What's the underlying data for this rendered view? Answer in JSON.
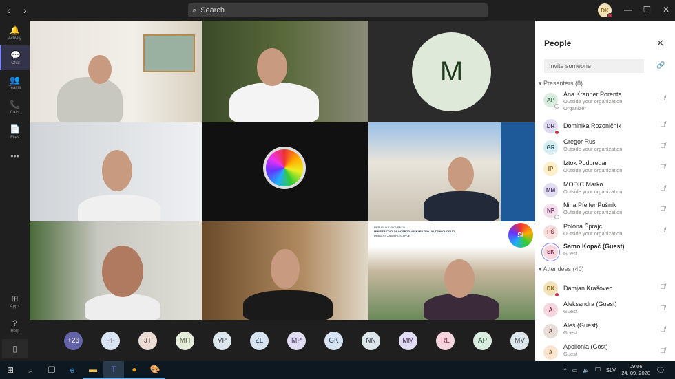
{
  "titlebar": {
    "search_placeholder": "Search",
    "user_initials": "DK"
  },
  "rail": [
    {
      "label": "Activity",
      "icon": "bell-icon",
      "g": "🔔"
    },
    {
      "label": "Chat",
      "icon": "chat-icon",
      "g": "💬"
    },
    {
      "label": "Teams",
      "icon": "teams-icon",
      "g": "👥"
    },
    {
      "label": "Calls",
      "icon": "phone-icon",
      "g": "📞"
    },
    {
      "label": "Files",
      "icon": "file-icon",
      "g": "📄"
    },
    {
      "label": "",
      "icon": "more-icon",
      "g": "•••"
    }
  ],
  "rail_bottom": [
    {
      "label": "Apps",
      "g": "⊞"
    },
    {
      "label": "Help",
      "g": "?"
    }
  ],
  "stage": {
    "m_initial": "M",
    "slide": {
      "line1": "REPUBLIKA SLOVENIJA",
      "line2": "MINISTRSTVO ZA GOSPODARSKI RAZVOJ IN TEHNOLOGIJO",
      "line3": "URAD RS ZA MEROSLOVJE",
      "badge": "SI"
    }
  },
  "overflow": [
    {
      "i": "+26",
      "c": "#6264a7",
      "t": "#fff"
    },
    {
      "i": "PF",
      "c": "#dbe4f3",
      "t": "#3a4a6a"
    },
    {
      "i": "JT",
      "c": "#ecdcd6",
      "t": "#6a4a3a"
    },
    {
      "i": "MH",
      "c": "#e6eedb",
      "t": "#4a5a3a"
    },
    {
      "i": "VP",
      "c": "#dde6ea",
      "t": "#3a4a5a"
    },
    {
      "i": "ZL",
      "c": "#d7e3f1",
      "t": "#2a4a6a"
    },
    {
      "i": "MP",
      "c": "#e0dcf1",
      "t": "#4a3a6a"
    },
    {
      "i": "GK",
      "c": "#d7e3f1",
      "t": "#2a4a6a"
    },
    {
      "i": "NN",
      "c": "#dde6ea",
      "t": "#3a4a5a"
    },
    {
      "i": "MM",
      "c": "#e0dcf1",
      "t": "#4a3a6a"
    },
    {
      "i": "RL",
      "c": "#f6d6de",
      "t": "#8a2a4a"
    },
    {
      "i": "AP",
      "c": "#d9ecdf",
      "t": "#2a5a3a"
    },
    {
      "i": "MV",
      "c": "#dde6ea",
      "t": "#3a4a5a"
    }
  ],
  "panel": {
    "title": "People",
    "invite_placeholder": "Invite someone",
    "presenters_label": "Presenters (8)",
    "attendees_label": "Attendees (40)",
    "presenters": [
      {
        "i": "AP",
        "name": "Ana Kranner Porenta",
        "sub": "Outside your organization",
        "sub2": "Organizer",
        "c": "#d9ecdf",
        "t": "#2a5a3a",
        "st": "away"
      },
      {
        "i": "DR",
        "name": "Dominika Rozoničnik",
        "c": "#e0dcf1",
        "t": "#4a3a6a",
        "st": "busy"
      },
      {
        "i": "GR",
        "name": "Gregor Rus",
        "sub": "Outside your organization",
        "c": "#d6eef0",
        "t": "#2a5a6a"
      },
      {
        "i": "IP",
        "name": "Iztok Podbregar",
        "sub": "Outside your organization",
        "c": "#fcefc9",
        "t": "#8a6a1f"
      },
      {
        "i": "MM",
        "name": "MODIC Marko",
        "sub": "Outside your organization",
        "c": "#e0dcf1",
        "t": "#4a3a6a"
      },
      {
        "i": "NP",
        "name": "Nina Pfeifer Pušnik",
        "sub": "Outside your organization",
        "c": "#f1dcea",
        "t": "#6a2a5a",
        "st": "away"
      },
      {
        "i": "PŠ",
        "name": "Polona Šprajc",
        "sub": "Outside your organization",
        "c": "#f6dede",
        "t": "#8a3a3a"
      },
      {
        "i": "SK",
        "name": "Samo Kopač (Guest)",
        "sub": "Guest",
        "c": "#f6d6de",
        "t": "#8a2a4a",
        "bold": true
      }
    ],
    "attendees": [
      {
        "i": "DK",
        "name": "Damjan Krašovec",
        "c": "#f3e2b8",
        "t": "#8a6a1f",
        "st": "busy"
      },
      {
        "i": "A",
        "name": "Aleksandra (Guest)",
        "sub": "Guest",
        "c": "#f6d6de",
        "t": "#8a2a4a"
      },
      {
        "i": "A",
        "name": "Aleš (Guest)",
        "sub": "Guest",
        "c": "#e8ddd8",
        "t": "#6a4a3a"
      },
      {
        "i": "A",
        "name": "Apollonia (Gost)",
        "sub": "Guest",
        "c": "#fbe5d0",
        "t": "#8a5a2a"
      }
    ]
  },
  "taskbar": {
    "lang": "SLV",
    "time": "09:06",
    "date": "24. 09. 2020"
  }
}
